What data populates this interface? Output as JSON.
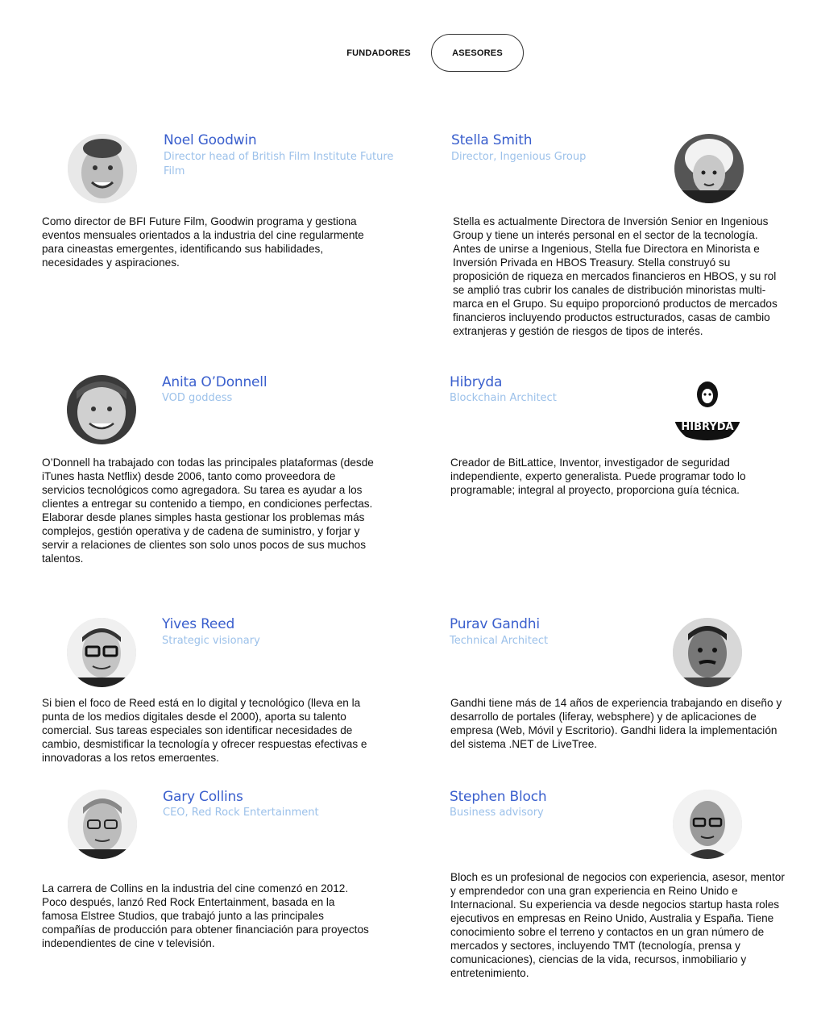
{
  "tabs": [
    {
      "label": "FUNDADORES",
      "active": false
    },
    {
      "label": "ASESORES",
      "active": true
    }
  ],
  "colors": {
    "name": "#3a5fcd",
    "role": "#9cc1ea",
    "text": "#111111"
  },
  "advisors": [
    {
      "name": "Noel Goodwin",
      "role": "Director head of British Film Institute Future Film",
      "bio": "Como director de BFI Future Film, Goodwin programa y gestiona eventos mensuales orientados a la industria del cine regularmente para cineastas emergentes, identificando sus habilidades, necesidades y aspiraciones."
    },
    {
      "name": "Stella Smith",
      "role": "Director, Ingenious Group",
      "bio": "Stella es actualmente Directora de Inversión Senior en Ingenious Group y tiene un interés personal en el sector de la tecnología. Antes de unirse a Ingenious, Stella fue Directora en Minorista e Inversión Privada en HBOS Treasury. Stella construyó su proposición de riqueza en mercados financieros en HBOS, y su rol se amplió tras cubrir los canales de distribución minoristas multi-marca en el Grupo. Su equipo proporcionó productos de mercados financieros incluyendo productos estructurados, casas de cambio extranjeras y gestión de riesgos de tipos de interés."
    },
    {
      "name": "Anita O’Donnell",
      "role": "VOD goddess",
      "bio": "O’Donnell ha trabajado con todas las principales plataformas (desde iTunes hasta Netflix) desde 2006, tanto como proveedora de servicios tecnológicos como agregadora. Su tarea es ayudar a los clientes a entregar su contenido a tiempo, en condiciones perfectas. Elaborar desde planes simples hasta gestionar los problemas más complejos, gestión operativa y de cadena de suministro, y forjar y servir a relaciones de clientes son solo unos pocos de sus muchos talentos."
    },
    {
      "name": "Hibryda",
      "role": "Blockchain Architect",
      "logo_text": "HIBRYDA",
      "bio": "Creador de BitLattice, Inventor, investigador de seguridad independiente, experto generalista. Puede programar todo lo programable; integral al proyecto, proporciona guía técnica."
    },
    {
      "name": "Yives Reed",
      "role": "Strategic visionary",
      "bio": "Si bien el foco de Reed está en lo digital y tecnológico (lleva en la punta de los medios digitales desde el 2000), aporta su talento comercial. Sus tareas especiales son identificar necesidades de cambio, desmistificar la tecnología y ofrecer respuestas efectivas e innovadoras a los retos emergentes."
    },
    {
      "name": "Purav Gandhi",
      "role": "Technical Architect",
      "bio": "Gandhi tiene más de 14 años de experiencia trabajando en diseño y desarrollo de portales (liferay, websphere) y de aplicaciones de empresa (Web, Móvil y Escritorio). Gandhi lidera la implementación del sistema .NET de LiveTree."
    },
    {
      "name": "Gary Collins",
      "role": "CEO, Red Rock Entertainment",
      "bio": "La carrera de Collins en la industria del cine comenzó en 2012. Poco después, lanzó Red Rock Entertainment, basada en la famosa Elstree Studios, que trabajó junto a las principales compañías de producción para obtener financiación para proyectos independientes de cine y televisión."
    },
    {
      "name": "Stephen Bloch",
      "role": "Business advisory",
      "bio": "Bloch es un profesional de negocios con experiencia, asesor, mentor y emprendedor con una gran experiencia en Reino Unido e Internacional. Su experiencia va desde negocios startup hasta roles ejecutivos en empresas en Reino Unido, Australia y España. Tiene conocimiento sobre el terreno y contactos en un gran número de mercados y sectores, incluyendo TMT (tecnología, prensa y comunicaciones), ciencias de la vida, recursos, inmobiliario y entretenimiento."
    }
  ]
}
